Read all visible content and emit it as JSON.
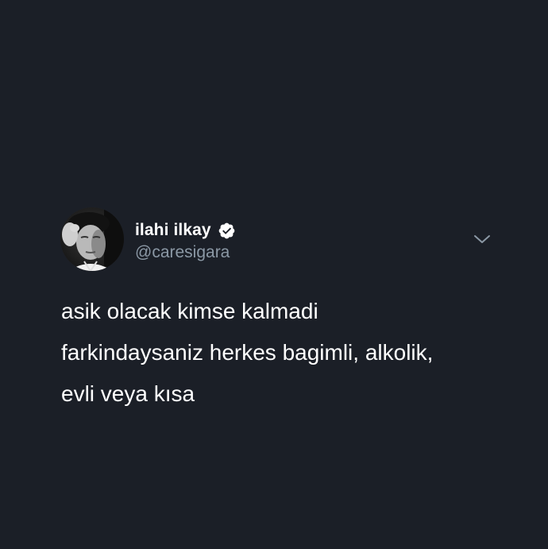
{
  "tweet": {
    "author": {
      "display_name": "ilahi ilkay",
      "handle": "@caresigara",
      "verified": true,
      "avatar_icon": "profile-photo"
    },
    "menu_icon": "chevron-down-icon",
    "text_lines": [
      "asik olacak kimse kalmadi",
      "farkindaysaniz herkes bagimli, alkolik,",
      "evli veya kısa"
    ]
  },
  "colors": {
    "background": "#1b1f27",
    "text": "#ffffff",
    "handle": "#8b98a5",
    "verified_badge": "#ffffff"
  }
}
